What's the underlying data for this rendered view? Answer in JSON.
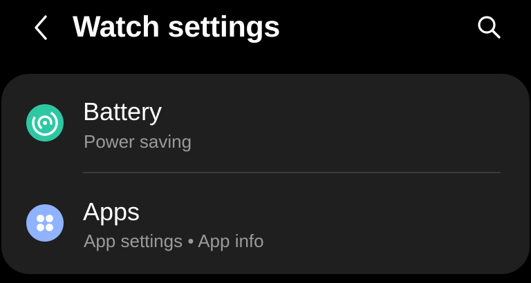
{
  "header": {
    "title": "Watch settings",
    "back_icon": "chevron-left-icon",
    "search_icon": "search-icon"
  },
  "settings": {
    "items": [
      {
        "label": "Battery",
        "subtitle": "Power saving",
        "icon": "battery-power-icon",
        "icon_color": "#2ec7a3"
      },
      {
        "label": "Apps",
        "subtitle": "App settings • App info",
        "icon": "apps-grid-icon",
        "icon_color": "#8fb3ff"
      }
    ]
  },
  "colors": {
    "background": "#000000",
    "card": "#1f1f1f",
    "title_text": "#ffffff",
    "subtitle_text": "#9a9a9a",
    "divider": "#3a3a3a"
  }
}
